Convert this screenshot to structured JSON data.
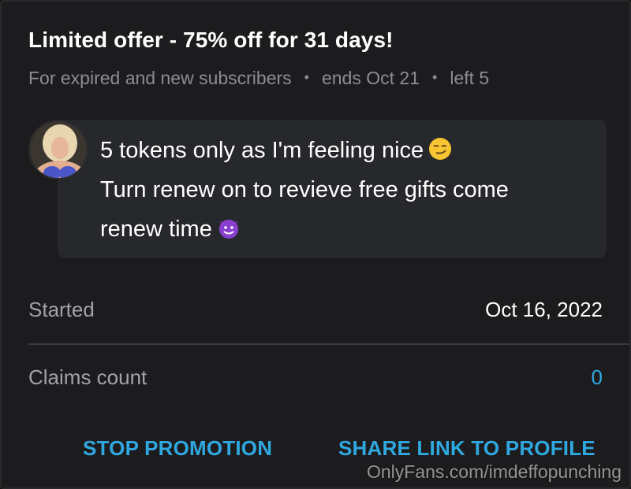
{
  "offer": {
    "title": "Limited offer - 75% off for 31 days!",
    "audience": "For expired and new subscribers",
    "ends": "ends Oct 21",
    "left": "left 5"
  },
  "message": {
    "line1": "5 tokens only as I'm feeling nice",
    "line2": "Turn renew on to revieve free gifts come",
    "line3": "renew time",
    "emoji1": "smirk-emoji",
    "emoji2": "devil-emoji"
  },
  "details": {
    "started_label": "Started",
    "started_value": "Oct 16, 2022",
    "claims_label": "Claims count",
    "claims_value": "0"
  },
  "actions": {
    "stop_label": "STOP PROMOTION",
    "share_label": "SHARE LINK TO PROFILE"
  },
  "watermark": "OnlyFans.com/imdeffopunching",
  "colors": {
    "accent": "#2fa8e0",
    "background": "#1c1c1e",
    "bubble": "#26282b",
    "muted": "#8a8d91"
  }
}
